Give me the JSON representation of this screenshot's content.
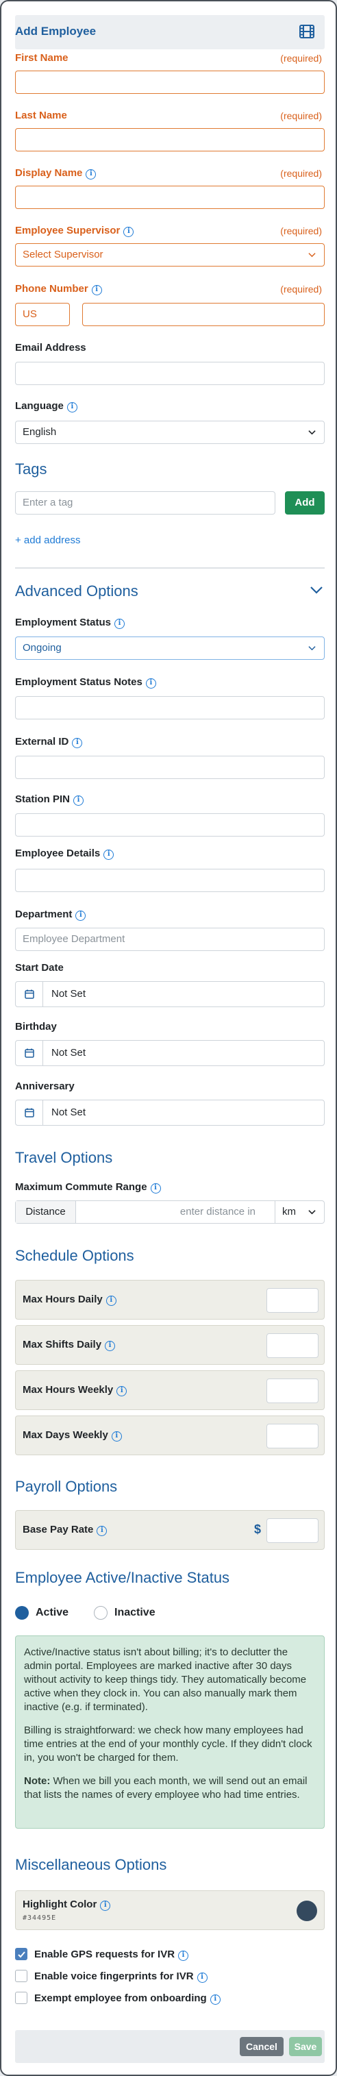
{
  "header": {
    "title": "Add Employee",
    "icon": "film-icon"
  },
  "required_text": "(required)",
  "fields": {
    "first_name": {
      "label": "First Name"
    },
    "last_name": {
      "label": "Last Name"
    },
    "display_name": {
      "label": "Display Name"
    },
    "supervisor": {
      "label": "Employee Supervisor",
      "value": "Select Supervisor"
    },
    "phone": {
      "label": "Phone Number",
      "country": "US"
    },
    "email": {
      "label": "Email Address"
    },
    "language": {
      "label": "Language",
      "value": "English"
    }
  },
  "tags": {
    "title": "Tags",
    "placeholder": "Enter a tag",
    "add_label": "Add",
    "add_address": "+ add address"
  },
  "advanced": {
    "title": "Advanced Options",
    "employment_status": {
      "label": "Employment Status",
      "value": "Ongoing"
    },
    "status_notes": {
      "label": "Employment Status Notes"
    },
    "external_id": {
      "label": "External ID"
    },
    "station_pin": {
      "label": "Station PIN"
    },
    "details": {
      "label": "Employee Details"
    },
    "department": {
      "label": "Department",
      "placeholder": "Employee Department"
    },
    "start_date": {
      "label": "Start Date",
      "value": "Not Set"
    },
    "birthday": {
      "label": "Birthday",
      "value": "Not Set"
    },
    "anniversary": {
      "label": "Anniversary",
      "value": "Not Set"
    }
  },
  "travel": {
    "title": "Travel Options",
    "commute_label": "Maximum Commute Range",
    "distance_label": "Distance",
    "distance_placeholder": "enter distance in",
    "unit": "km"
  },
  "schedule": {
    "title": "Schedule Options",
    "rows": [
      "Max Hours Daily",
      "Max Shifts Daily",
      "Max Hours Weekly",
      "Max Days Weekly"
    ]
  },
  "payroll": {
    "title": "Payroll Options",
    "base_pay_label": "Base Pay Rate",
    "currency": "$"
  },
  "status": {
    "title": "Employee Active/Inactive Status",
    "active_label": "Active",
    "inactive_label": "Inactive",
    "selected": "Active",
    "note_p1": "Active/Inactive status isn't about billing; it's to declutter the admin portal. Employees are marked inactive after 30 days without activity to keep things tidy. They automatically become active when they clock in. You can also manually mark them inactive (e.g. if terminated).",
    "note_p2": "Billing is straightforward: we check how many employees had time entries at the end of your monthly cycle. If they didn't clock in, you won't be charged for them.",
    "note_p3_bold": "Note:",
    "note_p3": " When we bill you each month, we will send out an email that lists the names of every employee who had time entries."
  },
  "misc": {
    "title": "Miscellaneous Options",
    "highlight_label": "Highlight Color",
    "highlight_hex": "#34495E",
    "highlight_color": "#34495e",
    "checkboxes": [
      {
        "label": "Enable GPS requests for IVR",
        "checked": true
      },
      {
        "label": "Enable voice fingerprints for IVR",
        "checked": false
      },
      {
        "label": "Exempt employee from onboarding",
        "checked": false
      }
    ]
  },
  "footer": {
    "cancel_label": "Cancel",
    "save_label": "Save"
  },
  "colors": {
    "accent": "#1f5f9e",
    "required": "#d9601b",
    "add_button": "#1f8f56"
  }
}
